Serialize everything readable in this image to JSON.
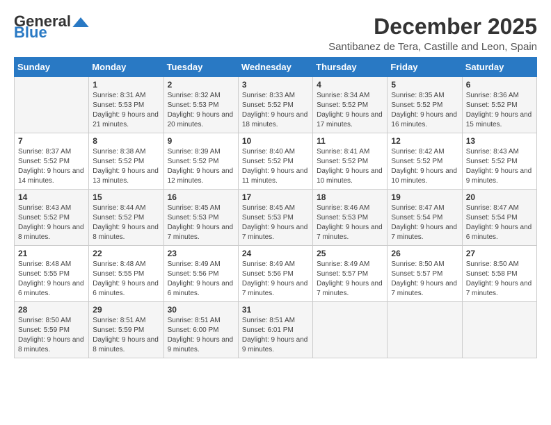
{
  "logo": {
    "general": "General",
    "blue": "Blue"
  },
  "title": "December 2025",
  "location": "Santibanez de Tera, Castille and Leon, Spain",
  "days_of_week": [
    "Sunday",
    "Monday",
    "Tuesday",
    "Wednesday",
    "Thursday",
    "Friday",
    "Saturday"
  ],
  "weeks": [
    [
      {
        "day": "",
        "info": ""
      },
      {
        "day": "1",
        "info": "Sunrise: 8:31 AM\nSunset: 5:53 PM\nDaylight: 9 hours and 21 minutes."
      },
      {
        "day": "2",
        "info": "Sunrise: 8:32 AM\nSunset: 5:53 PM\nDaylight: 9 hours and 20 minutes."
      },
      {
        "day": "3",
        "info": "Sunrise: 8:33 AM\nSunset: 5:52 PM\nDaylight: 9 hours and 18 minutes."
      },
      {
        "day": "4",
        "info": "Sunrise: 8:34 AM\nSunset: 5:52 PM\nDaylight: 9 hours and 17 minutes."
      },
      {
        "day": "5",
        "info": "Sunrise: 8:35 AM\nSunset: 5:52 PM\nDaylight: 9 hours and 16 minutes."
      },
      {
        "day": "6",
        "info": "Sunrise: 8:36 AM\nSunset: 5:52 PM\nDaylight: 9 hours and 15 minutes."
      }
    ],
    [
      {
        "day": "7",
        "info": "Sunrise: 8:37 AM\nSunset: 5:52 PM\nDaylight: 9 hours and 14 minutes."
      },
      {
        "day": "8",
        "info": "Sunrise: 8:38 AM\nSunset: 5:52 PM\nDaylight: 9 hours and 13 minutes."
      },
      {
        "day": "9",
        "info": "Sunrise: 8:39 AM\nSunset: 5:52 PM\nDaylight: 9 hours and 12 minutes."
      },
      {
        "day": "10",
        "info": "Sunrise: 8:40 AM\nSunset: 5:52 PM\nDaylight: 9 hours and 11 minutes."
      },
      {
        "day": "11",
        "info": "Sunrise: 8:41 AM\nSunset: 5:52 PM\nDaylight: 9 hours and 10 minutes."
      },
      {
        "day": "12",
        "info": "Sunrise: 8:42 AM\nSunset: 5:52 PM\nDaylight: 9 hours and 10 minutes."
      },
      {
        "day": "13",
        "info": "Sunrise: 8:43 AM\nSunset: 5:52 PM\nDaylight: 9 hours and 9 minutes."
      }
    ],
    [
      {
        "day": "14",
        "info": "Sunrise: 8:43 AM\nSunset: 5:52 PM\nDaylight: 9 hours and 8 minutes."
      },
      {
        "day": "15",
        "info": "Sunrise: 8:44 AM\nSunset: 5:52 PM\nDaylight: 9 hours and 8 minutes."
      },
      {
        "day": "16",
        "info": "Sunrise: 8:45 AM\nSunset: 5:53 PM\nDaylight: 9 hours and 7 minutes."
      },
      {
        "day": "17",
        "info": "Sunrise: 8:45 AM\nSunset: 5:53 PM\nDaylight: 9 hours and 7 minutes."
      },
      {
        "day": "18",
        "info": "Sunrise: 8:46 AM\nSunset: 5:53 PM\nDaylight: 9 hours and 7 minutes."
      },
      {
        "day": "19",
        "info": "Sunrise: 8:47 AM\nSunset: 5:54 PM\nDaylight: 9 hours and 7 minutes."
      },
      {
        "day": "20",
        "info": "Sunrise: 8:47 AM\nSunset: 5:54 PM\nDaylight: 9 hours and 6 minutes."
      }
    ],
    [
      {
        "day": "21",
        "info": "Sunrise: 8:48 AM\nSunset: 5:55 PM\nDaylight: 9 hours and 6 minutes."
      },
      {
        "day": "22",
        "info": "Sunrise: 8:48 AM\nSunset: 5:55 PM\nDaylight: 9 hours and 6 minutes."
      },
      {
        "day": "23",
        "info": "Sunrise: 8:49 AM\nSunset: 5:56 PM\nDaylight: 9 hours and 6 minutes."
      },
      {
        "day": "24",
        "info": "Sunrise: 8:49 AM\nSunset: 5:56 PM\nDaylight: 9 hours and 7 minutes."
      },
      {
        "day": "25",
        "info": "Sunrise: 8:49 AM\nSunset: 5:57 PM\nDaylight: 9 hours and 7 minutes."
      },
      {
        "day": "26",
        "info": "Sunrise: 8:50 AM\nSunset: 5:57 PM\nDaylight: 9 hours and 7 minutes."
      },
      {
        "day": "27",
        "info": "Sunrise: 8:50 AM\nSunset: 5:58 PM\nDaylight: 9 hours and 7 minutes."
      }
    ],
    [
      {
        "day": "28",
        "info": "Sunrise: 8:50 AM\nSunset: 5:59 PM\nDaylight: 9 hours and 8 minutes."
      },
      {
        "day": "29",
        "info": "Sunrise: 8:51 AM\nSunset: 5:59 PM\nDaylight: 9 hours and 8 minutes."
      },
      {
        "day": "30",
        "info": "Sunrise: 8:51 AM\nSunset: 6:00 PM\nDaylight: 9 hours and 9 minutes."
      },
      {
        "day": "31",
        "info": "Sunrise: 8:51 AM\nSunset: 6:01 PM\nDaylight: 9 hours and 9 minutes."
      },
      {
        "day": "",
        "info": ""
      },
      {
        "day": "",
        "info": ""
      },
      {
        "day": "",
        "info": ""
      }
    ]
  ]
}
